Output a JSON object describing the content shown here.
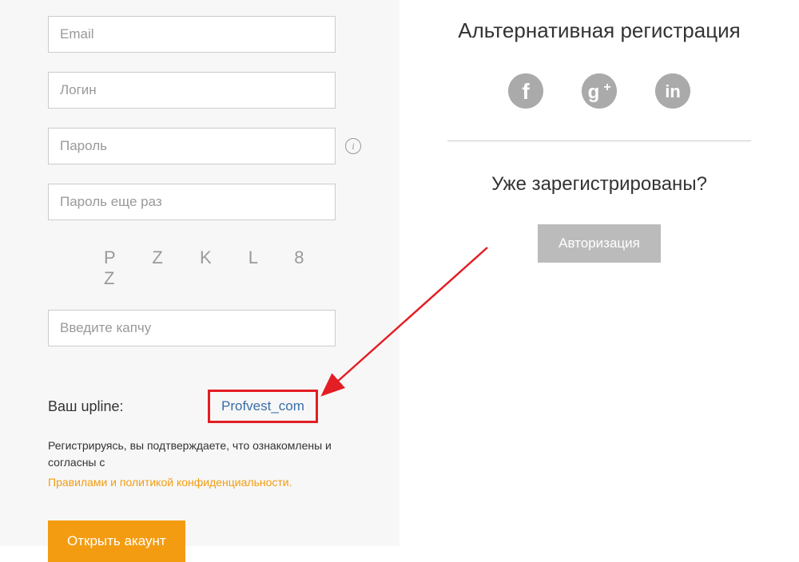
{
  "form": {
    "email_placeholder": "Email",
    "login_placeholder": "Логин",
    "password_placeholder": "Пароль",
    "password_repeat_placeholder": "Пароль еще раз",
    "captcha_text": "PZKL8Z",
    "captcha_placeholder": "Введите капчу",
    "upline_label": "Ваш upline:",
    "upline_value": "Profvest_com",
    "agreement_text": "Регистрируясь, вы подтверждаете, что ознакомлены и согласны с",
    "agreement_link": "Правилами и политикой конфиденциальности.",
    "submit_label": "Открыть акаунт"
  },
  "alt": {
    "title": "Альтернативная регистрация",
    "already_title": "Уже зарегистрированы?",
    "login_label": "Авторизация"
  },
  "icons": {
    "info": "i",
    "facebook": "f",
    "googleplus": "g+",
    "linkedin": "in"
  }
}
